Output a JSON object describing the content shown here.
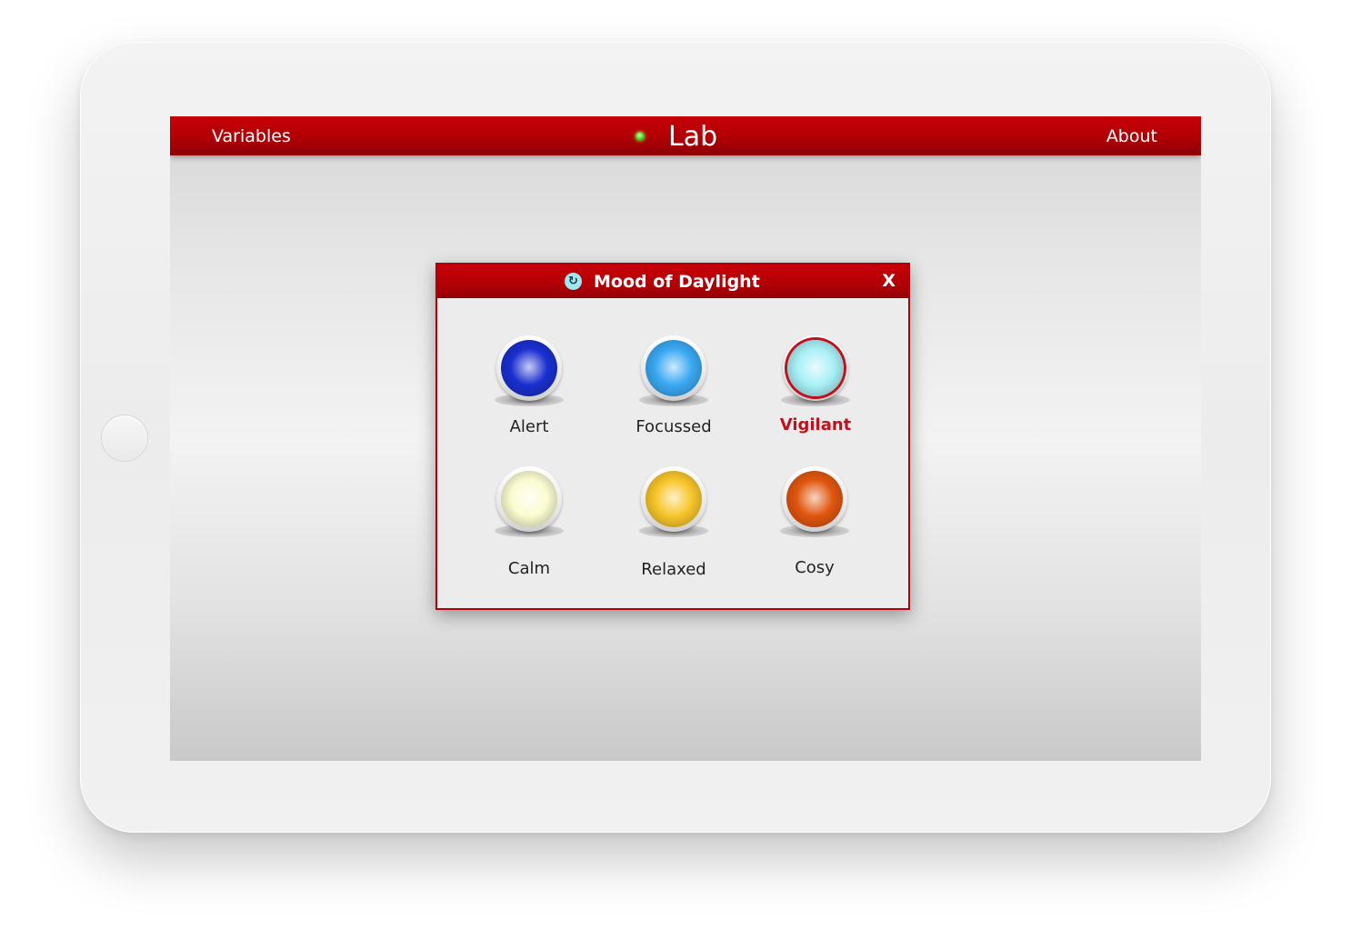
{
  "app": {
    "title": "Lab",
    "status": "online"
  },
  "nav": {
    "left_label": "Variables",
    "right_label": "About"
  },
  "dialog": {
    "title": "Mood of Daylight",
    "close_label": "X",
    "selected": "Vigilant",
    "moods": [
      {
        "label": "Alert",
        "color": "#1a2fd0",
        "selected": false
      },
      {
        "label": "Focussed",
        "color": "#3aa8f2",
        "selected": false
      },
      {
        "label": "Vigilant",
        "color": "#a8f0f6",
        "selected": true
      },
      {
        "label": "Calm",
        "color": "#fbfbd0",
        "selected": false
      },
      {
        "label": "Relaxed",
        "color": "#f7c52a",
        "selected": false
      },
      {
        "label": "Cosy",
        "color": "#e0560e",
        "selected": false
      }
    ]
  },
  "colors": {
    "accent": "#b00006",
    "status_green": "#59d42d"
  }
}
